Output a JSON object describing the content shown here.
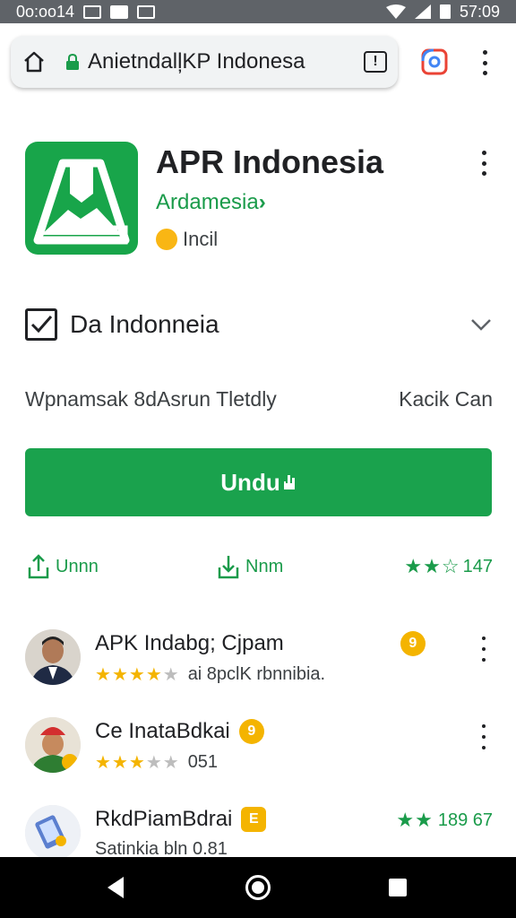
{
  "status_bar": {
    "time_left": "0o:oo14",
    "time_right": "57:09"
  },
  "browser": {
    "url": "Anietndall̦KP Indonesa",
    "alert_glyph": "!"
  },
  "app": {
    "title": "APR Indonesia",
    "developer": "Ardamesia",
    "developer_arrow": "›",
    "meta_label": "Incil",
    "icon_color": "#18a54a"
  },
  "section": {
    "label": "Da Indonneia"
  },
  "info": {
    "left": "Wpnamsak 8dAsrun Tletdly",
    "right": "Kacik Can"
  },
  "install": {
    "label": "Undu"
  },
  "actions": [
    {
      "label": "Unnn"
    },
    {
      "label": "Nnm"
    },
    {
      "label": "147"
    }
  ],
  "reviews": [
    {
      "name": "APK Indabg; Cjpam",
      "badge": "9",
      "stars_on": 4,
      "stars_total": 5,
      "text": "ai 8pclK rbnnibia."
    },
    {
      "name": "Ce InataBdkai",
      "badge": "9",
      "stars_on": 3,
      "stars_total": 5,
      "text": "051"
    },
    {
      "name": "RkdPiamBdrai",
      "badge": "E",
      "stars_on": 2,
      "stars_total": 2,
      "text": "Satinkia bln 0.81",
      "right_value": "189 67"
    }
  ],
  "colors": {
    "accent": "#1aa24d",
    "star": "#f4b400",
    "status_bar": "#5f6368"
  }
}
